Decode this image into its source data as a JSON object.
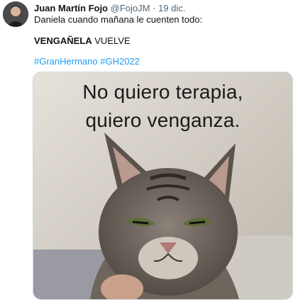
{
  "tweet": {
    "author_name": "Juan Martín Fojo",
    "author_handle": "@FojoJM",
    "separator": "·",
    "date": "19 dic.",
    "line1": "Daniela cuando mañana le cuenten todo:",
    "line2_bold": "VENGAÑELA",
    "line2_rest": "VUELVE",
    "hashtag1": "#GranHermano",
    "hashtag2": "#GH2022"
  },
  "media": {
    "caption_line1": "No quiero terapia,",
    "caption_line2": "quiero venganza."
  },
  "colors": {
    "link": "#1d9bf0",
    "secondary_text": "#536471",
    "primary_text": "#0f1419"
  }
}
